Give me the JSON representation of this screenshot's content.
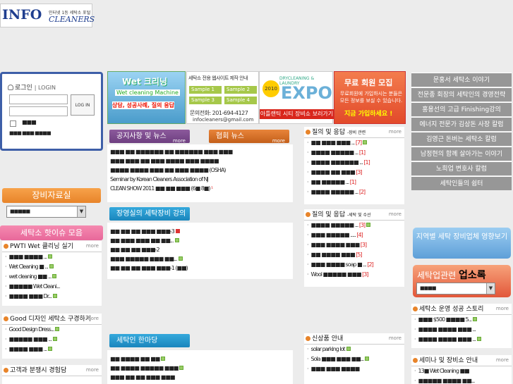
{
  "logo": {
    "big": "INFO",
    "tagline": "인터넷 1등 세탁소 포털",
    "cleaners": "CLEANERS"
  },
  "login": {
    "title": "로그인",
    "title_en": "LOGIN",
    "button": "LOG IN",
    "save_id": "■■■",
    "links": "■■■  ■■■ ■■■■"
  },
  "left": {
    "equipment_tab": "장비자료실",
    "equipment_select": "■■■■■",
    "hot_issue_tab": "세탁소 핫이슈 모음",
    "pwti": {
      "title": "PWTI Wet 클리닝 실기",
      "more": "more",
      "items": [
        "■■■ ■■■■ ...",
        "Wet Cleaning ■ ...",
        "wet cleaning ■■ ...",
        "■■■■■ Wet Cleani...",
        "■■■■ ■■■ Dr..."
      ]
    },
    "good": {
      "title": "Good 디자인 세탁소 구경하기",
      "more": "more",
      "items": [
        "Good Design Dress...",
        "■■■■■ ■■■ ...",
        "■■■■ ■■■ ..."
      ]
    },
    "customer": {
      "title": "고객과 분쟁시 경험담",
      "more": "more"
    }
  },
  "banners": {
    "wet": {
      "title": "Wet 크리닝",
      "sub": "Wet cleaning Machine",
      "desc": "상담, 성공사례, 질의 응답"
    },
    "web": {
      "header": "세탁소 전용 웹사이트 제작 안내",
      "samples": [
        "Sample 1",
        "Sample 2",
        "Sample 3",
        "Sample 4"
      ],
      "phone": "문의전화: 201-694-4127",
      "email": "infocleaners@gmail.com"
    },
    "expo": {
      "year": "2010",
      "desc": "DRYCLEANING & LAUNDRY",
      "title": "EXPO",
      "bottom": "아틀랜틱 시티 장비쇼 보러가기"
    },
    "member": {
      "title": "무료 회원 모집",
      "desc": "무료회원에 가입하시는 분들은 모든 정보를 보실 수 있습니다.",
      "cta": "지금 가입하세요 !"
    }
  },
  "center": {
    "notice_tab": "공지사항 및 뉴스",
    "assoc_tab": "협회 뉴스",
    "more": "more",
    "notice_lines": [
      "■■■ ■■ ■■■■■■ ■■ ■■■■■■ ■■■ ■■■",
      "■■■ ■■■ ■■ ■■■ ■■■■ ■■■ ■■■■",
      "■■■■ ■■■■ ■■■ ■■ ■■■ ■■■■ (OSHA)",
      "Seminar by Korean Cleaners Association of NJ",
      "CLEAN SHOW 2011 ■■ ■■ ■■■ (6■ 8■)"
    ],
    "jang_tab": "장영실의 세탁장비 강의",
    "jang_lines": [
      "■■ ■■ ■■ ■■■ ■■■-3",
      "■■ ■■■ ■■■ ■■ ■■...",
      "■■ ■■ ■■ ■■■-2",
      "■■■ ■■■■■ ■■■ ■■...",
      "■■ ■■ ■■ ■■■ ■■■-1 (■■)"
    ],
    "han_tab": "세탁인 한마당",
    "han_lines": [
      "■■ ■■■■ ■■ ■■",
      "■■ ■■■■ ■■■■■ ■■■",
      "■■■ ■■ ■■ ■■■ ■■■"
    ]
  },
  "qa1": {
    "title": "질의 및 응답",
    "sub": "-장비 관련",
    "more": "more",
    "items": [
      "■■ ■■■ ■■■ ...",
      "■■■■ ■■■■■ ...",
      "■■■■ ■■■■■■ ...",
      "■■■■ ■■ ■■■",
      "■■ ■■■■■ ...",
      "■■■■ ■■■■■ ..."
    ],
    "counts": [
      "[7]",
      "[1]",
      "[1]",
      "[3]",
      "[1]",
      "[2]"
    ]
  },
  "qa2": {
    "title": "질의 및 응답",
    "sub": "-세탁 및 수선",
    "more": "more",
    "items": [
      "■■■■ ■■■■■ ...",
      "■■■ ■■■■■ .....",
      "■■■ ■■■■ ■■■",
      "■■ ■■■■ ■■■",
      "■■■ ■■■■ soap ■ ...",
      "Wool ■■■■■ ■■■"
    ],
    "counts": [
      "[3]",
      "[4]",
      "[3]",
      "[5]",
      "[2]",
      "[3]"
    ]
  },
  "newp": {
    "title": "신상품 안내",
    "more": "more",
    "items": [
      "solar parking lot",
      "Sola ■■■ ■■■ ■■...",
      "■■■ ■■■ ■■■■"
    ]
  },
  "right": {
    "nav": [
      "문홍서 세탁소 이야기",
      "전문종 회장의 세탁인의 경영전략",
      "홍용선의 고급 Finishing강의",
      "에너지 전문가 김상돈 사장 칼럼",
      "김영근 돈버는 세탁소 칼럼",
      "남정현의 함께 살아가는 이야기",
      "노희업 변호사 칼럼",
      "세탁인들의 쉼터"
    ],
    "map_banner": "지역별 세탁 장비업체 영향보기",
    "dir_banner": "세탁업관련",
    "dir_bold": "업소록",
    "dir_select": "■■■■",
    "success": {
      "title": "세탁소 운영 성공 스토리",
      "more": "more",
      "items": [
        "■■■ $500 ■■■■ 5...",
        "■■■■ ■■■■ ■■■ ...",
        "■■■■ ■■■■ ■■■ ..."
      ]
    },
    "seminar": {
      "title": "세미나 및 장비쇼 안내",
      "more": "more",
      "items": [
        "13■ Wet Cleaning ■■",
        "■■■■■ ■■■■ ■■..."
      ]
    }
  }
}
